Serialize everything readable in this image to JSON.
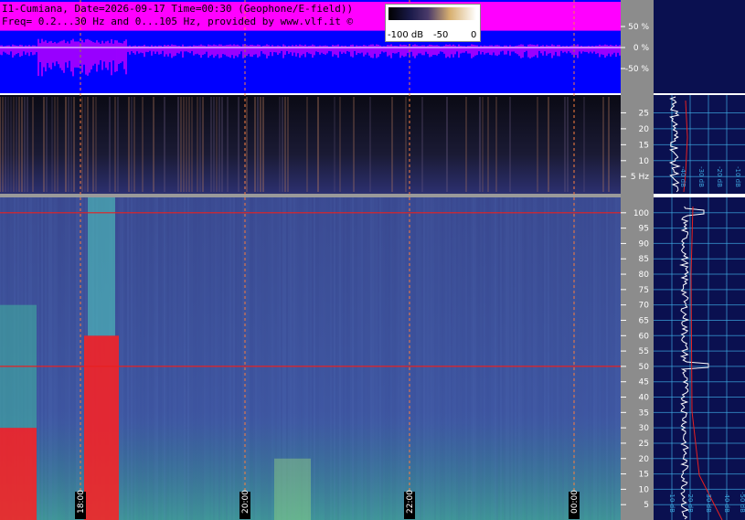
{
  "header": {
    "line1": "I1-Cumiana, Date=2026-09-17 Time=00:30 (Geophone/E-field))",
    "line2": "Freq= 0.2...30 Hz and 0...105 Hz, provided by www.vlf.it ©"
  },
  "colorbar": {
    "labels": [
      "-100 dB",
      "-50",
      "0"
    ]
  },
  "colors": {
    "waveform_bg": "#0000ff",
    "waveform_trace": "#ff00ff",
    "grid_line": "#ff8040",
    "spectrogram_bg": "#3a4a9a",
    "side_panel_bg": "#0a1050",
    "side_panel_grid": "#3da8e0",
    "axis_bg": "#8c8c8c",
    "mean_trace": "#ffffff",
    "peak_trace": "#e82020"
  },
  "chart_data": [
    {
      "type": "line",
      "panel": "waveform",
      "y_unit": "%",
      "ylim": [
        -100,
        100
      ],
      "y_ticks": [
        "50 %",
        "0 %",
        "-50 %"
      ]
    },
    {
      "type": "heatmap",
      "panel": "low-frequency spectrogram",
      "ylim": [
        0.2,
        30
      ],
      "y_ticks": [
        "25",
        "20",
        "15",
        "10",
        "5 Hz"
      ]
    },
    {
      "type": "heatmap",
      "panel": "main spectrogram",
      "ylim": [
        0,
        105
      ],
      "y_ticks": [
        "100",
        "95",
        "90",
        "85",
        "80",
        "75",
        "70",
        "65",
        "60",
        "55",
        "50",
        "45",
        "40",
        "35",
        "30",
        "25",
        "20",
        "15",
        "10",
        "5"
      ],
      "x_ticks": [
        "18:00",
        "20:00",
        "22:00",
        "00:00"
      ],
      "features": [
        {
          "kind": "horizontal line",
          "freq": 100
        },
        {
          "kind": "horizontal line",
          "freq": 50
        }
      ]
    },
    {
      "type": "line",
      "panel": "side spectrum (low band)",
      "x_ticks": [
        "-40 dB",
        "-30 dB",
        "-20 dB",
        "-10 dB"
      ],
      "series": []
    },
    {
      "type": "line",
      "panel": "side spectrum (main band)",
      "x_ticks": [
        "-10 dB",
        "-20 dB",
        "-30 dB",
        "-40 dB",
        "-50 dB"
      ],
      "series": []
    }
  ]
}
